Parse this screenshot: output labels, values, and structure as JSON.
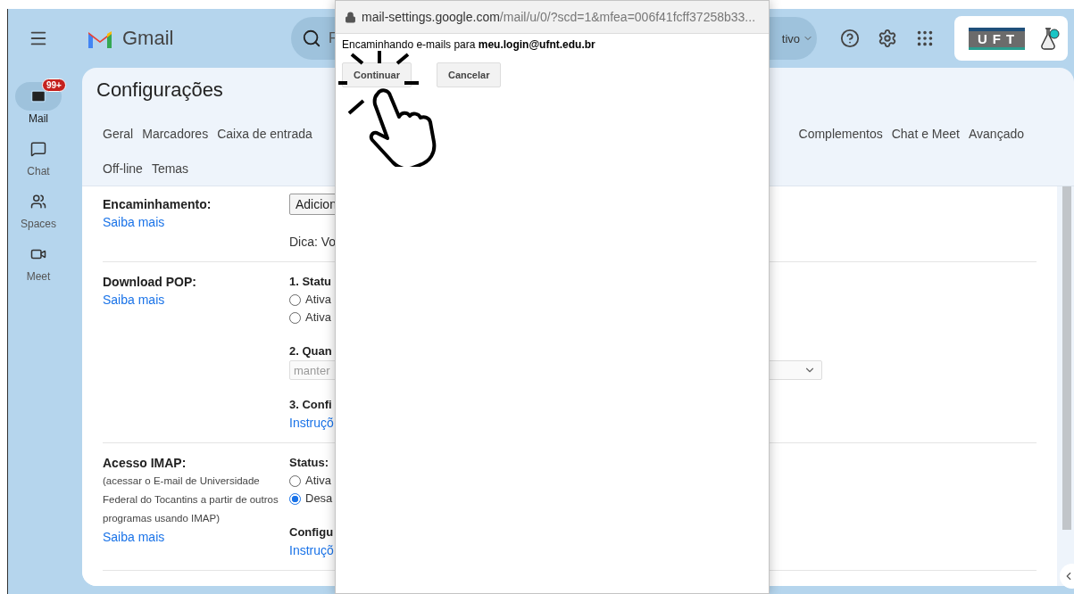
{
  "header": {
    "app_name": "Gmail",
    "search_fragment": "F",
    "status_fragment": "tivo",
    "org_logo": "UFT"
  },
  "nav": {
    "items": [
      {
        "kind": "mail",
        "label": "Mail",
        "selected": true,
        "badge": "99+"
      },
      {
        "kind": "chat",
        "label": "Chat",
        "selected": false
      },
      {
        "kind": "spaces",
        "label": "Spaces",
        "selected": false
      },
      {
        "kind": "meet",
        "label": "Meet",
        "selected": false
      }
    ]
  },
  "settings": {
    "title": "Configurações",
    "tab_rows": [
      {
        "start": [
          "Geral",
          "Marcadores",
          "Caixa de entrada"
        ],
        "end": [
          "Complementos",
          "Chat e Meet",
          "Avançado"
        ]
      },
      {
        "start": [
          "Off-line",
          "Temas"
        ],
        "end": []
      }
    ],
    "sections": [
      {
        "title": "Encaminhamento:",
        "link": "Saiba mais",
        "content": [
          {
            "kind": "button",
            "text": "Adicion"
          },
          {
            "kind": "note",
            "text": "Dica: Vo"
          }
        ]
      },
      {
        "title": "Download POP:",
        "link": "Saiba mais",
        "content": [
          {
            "kind": "heading",
            "text": "1. Statu"
          },
          {
            "kind": "radio",
            "text": "Ativa",
            "selected": false
          },
          {
            "kind": "radio",
            "text": "Ativa",
            "selected": false
          },
          {
            "kind": "heading",
            "text": "2. Quan"
          },
          {
            "kind": "select",
            "text": "manter"
          },
          {
            "kind": "heading",
            "text": "3. Confi"
          },
          {
            "kind": "link",
            "text": "Instruçõ"
          }
        ]
      },
      {
        "title": "Acesso IMAP:",
        "description": "(acessar o E-mail de Universidade Federal do Tocantins a partir de outros programas usando IMAP)",
        "link": "Saiba mais",
        "content": [
          {
            "kind": "heading",
            "text": "Status:"
          },
          {
            "kind": "radio",
            "text": "Ativa",
            "selected": false
          },
          {
            "kind": "radio",
            "text": "Desa",
            "selected": true
          },
          {
            "kind": "heading",
            "text": "Configu"
          },
          {
            "kind": "link",
            "text": "Instruçõ"
          }
        ]
      }
    ]
  },
  "popup": {
    "url_host": "mail-settings.google.com",
    "url_path": "/mail/u/0/?scd=1&mfea=006f41fcff37258b33...",
    "message": "Encaminhando e-mails para **meu.login@ufnt.edu.br**",
    "buttons": [
      "Continuar",
      "Cancelar"
    ]
  }
}
